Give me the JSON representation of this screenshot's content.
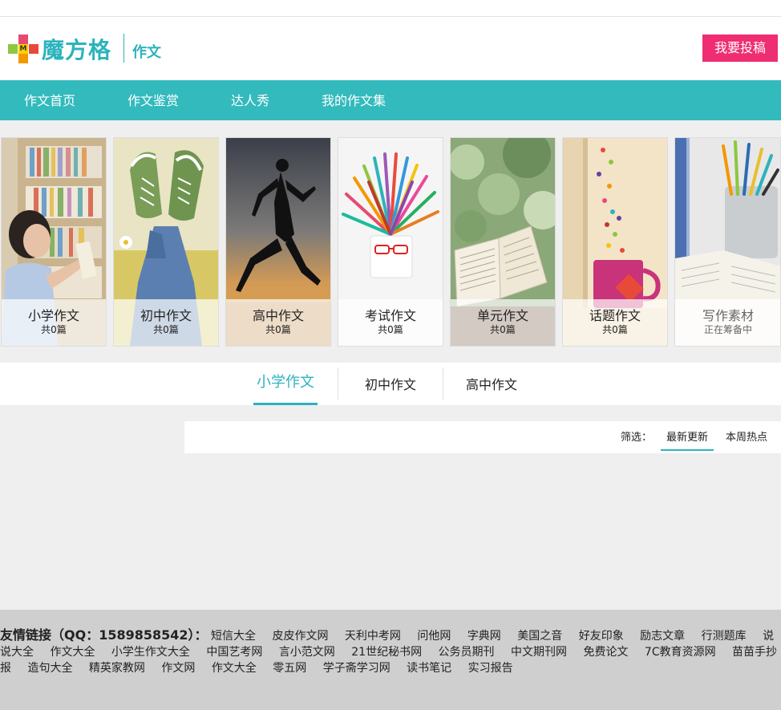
{
  "header": {
    "logo_text": "魔方格",
    "logo_mark_letter": "M",
    "section_title": "作文",
    "submit_label": "我要投稿"
  },
  "nav": {
    "items": [
      {
        "label": "作文首页"
      },
      {
        "label": "作文鉴赏"
      },
      {
        "label": "达人秀"
      },
      {
        "label": "我的作文集"
      }
    ]
  },
  "categories": [
    {
      "title": "小学作文",
      "count": "共0篇"
    },
    {
      "title": "初中作文",
      "count": "共0篇"
    },
    {
      "title": "高中作文",
      "count": "共0篇"
    },
    {
      "title": "考试作文",
      "count": "共0篇"
    },
    {
      "title": "单元作文",
      "count": "共0篇"
    },
    {
      "title": "话题作文",
      "count": "共0篇"
    },
    {
      "title": "写作素材",
      "count": "正在筹备中"
    }
  ],
  "tabs": [
    {
      "label": "小学作文",
      "active": true
    },
    {
      "label": "初中作文"
    },
    {
      "label": "高中作文"
    }
  ],
  "filter": {
    "label": "筛选：",
    "options": [
      {
        "label": "最新更新",
        "active": true
      },
      {
        "label": "本周热点"
      }
    ]
  },
  "footer": {
    "links_heading": "友情链接（QQ：1589858542）：",
    "links": [
      "短信大全",
      "皮皮作文网",
      "天利中考网",
      "问他网",
      "字典网",
      "美国之音",
      "好友印象",
      "励志文章",
      "行测题库",
      "说说大全",
      "作文大全",
      "小学生作文大全",
      "中国艺考网",
      "言小范文网",
      "21世纪秘书网",
      "公务员期刊",
      "中文期刊网",
      "免费论文",
      "7C教育资源网",
      "苗苗手抄报",
      "造句大全",
      "精英家教网",
      "作文网",
      "作文大全",
      "零五网",
      "学子斋学习网",
      "读书笔记",
      "实习报告"
    ]
  },
  "colors": {
    "accent": "#33babd",
    "brand_text": "#2cb3bc",
    "submit_button": "#ef2d72",
    "footer_bg": "#cfcfcf"
  }
}
